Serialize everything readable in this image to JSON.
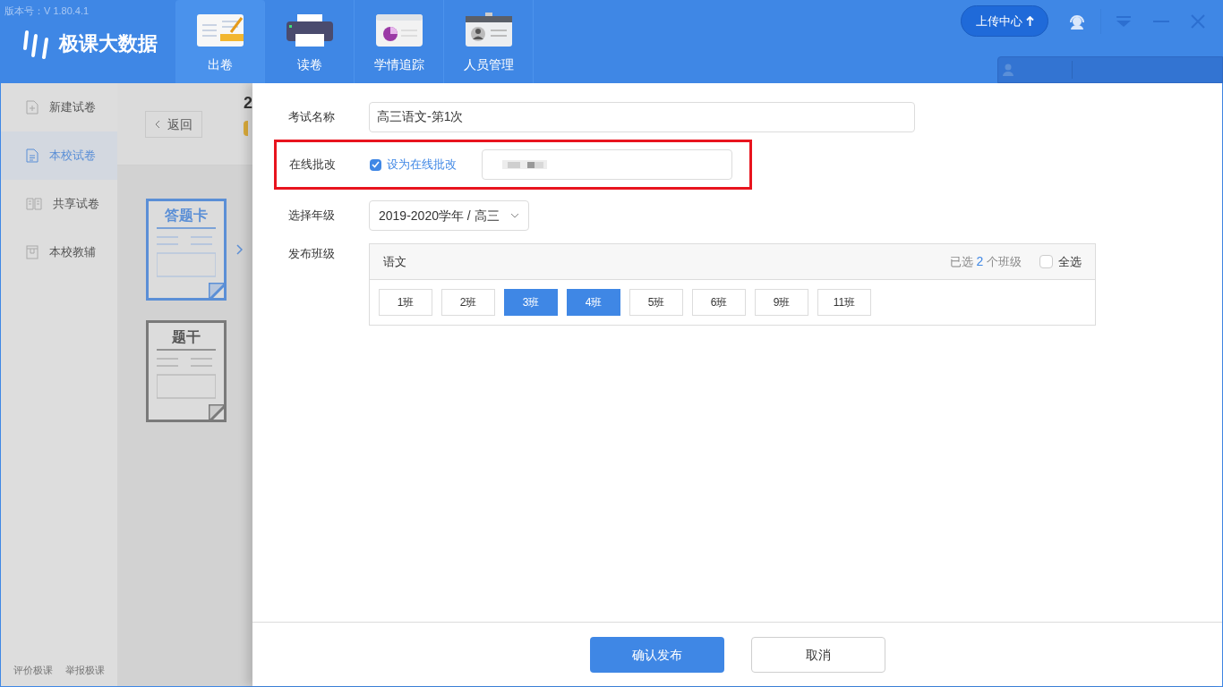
{
  "app": {
    "version": "版本号：V 1.80.4.1",
    "logo": "极课大数据"
  },
  "nav_tabs": [
    {
      "label": "出卷",
      "selected": true,
      "kind": "paper"
    },
    {
      "label": "读卷",
      "selected": false,
      "kind": "printer"
    },
    {
      "label": "学情追踪",
      "selected": false,
      "kind": "chart"
    },
    {
      "label": "人员管理",
      "selected": false,
      "kind": "badge"
    }
  ],
  "upload_button": "上传中心",
  "sidebar": {
    "items": [
      {
        "label": "新建试卷",
        "selected": false,
        "kind": "new"
      },
      {
        "label": "本校试卷",
        "selected": true,
        "kind": "doc"
      },
      {
        "label": "共享试卷",
        "selected": false,
        "kind": "book"
      },
      {
        "label": "本校教辅",
        "selected": false,
        "kind": "box"
      }
    ],
    "footer_links": [
      "评价极课",
      "举报极课"
    ]
  },
  "background": {
    "back_button": "返回",
    "heading": "2",
    "cards": [
      {
        "title": "答题卡",
        "selected": true
      },
      {
        "title": "题干",
        "selected": false
      }
    ]
  },
  "form": {
    "exam_name": {
      "label": "考试名称",
      "value": "高三语文-第1次"
    },
    "online_grading": {
      "label": "在线批改",
      "checked": true,
      "option": "设为在线批改",
      "highlighted": true
    },
    "grade": {
      "label": "选择年级",
      "value": "2019-2020学年 / 高三"
    },
    "classes": {
      "label": "发布班级",
      "subject": "语文",
      "selected_prefix": "已选",
      "selected_count": "2",
      "selected_suffix": "个班级",
      "select_all": {
        "label": "全选",
        "checked": false
      },
      "items": [
        {
          "label": "1班",
          "selected": false
        },
        {
          "label": "2班",
          "selected": false
        },
        {
          "label": "3班",
          "selected": true
        },
        {
          "label": "4班",
          "selected": true
        },
        {
          "label": "5班",
          "selected": false
        },
        {
          "label": "6班",
          "selected": false
        },
        {
          "label": "9班",
          "selected": false
        },
        {
          "label": "11班",
          "selected": false
        }
      ]
    }
  },
  "footer": {
    "confirm": "确认发布",
    "cancel": "取消"
  }
}
